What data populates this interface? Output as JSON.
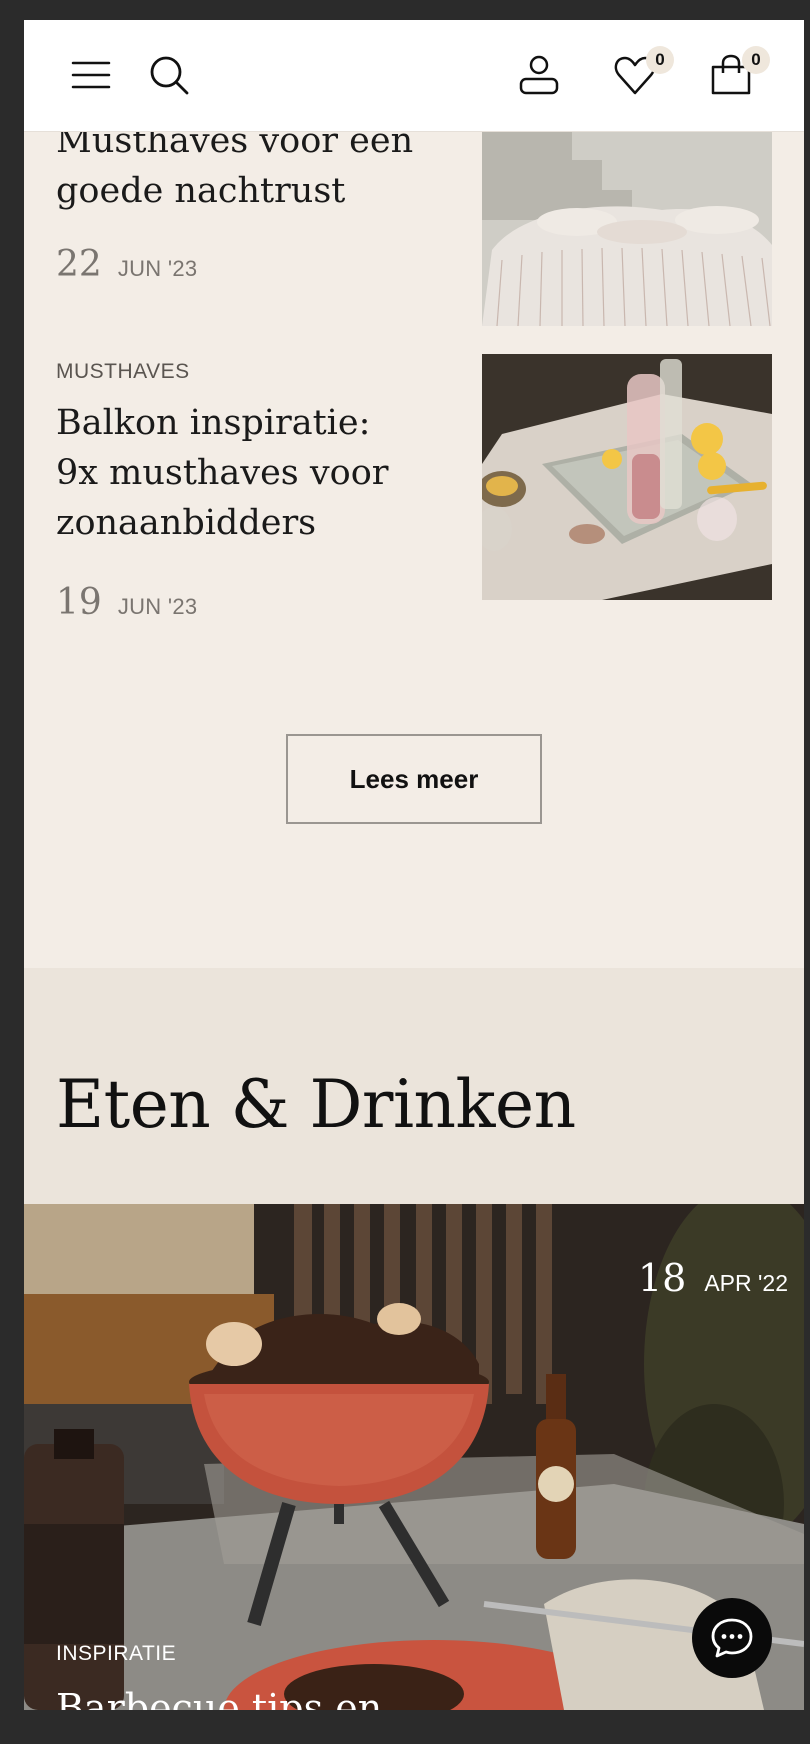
{
  "header": {
    "menu_icon": "hamburger-icon",
    "search_icon": "search-icon",
    "account_icon": "user-icon",
    "wishlist_icon": "heart-icon",
    "wishlist_count": "0",
    "cart_icon": "shopping-bag-icon",
    "cart_count": "0"
  },
  "articles": [
    {
      "category": "",
      "title": "Musthaves voor een goede nachtrust",
      "day": "22",
      "month": "JUN '23"
    },
    {
      "category": "MUSTHAVES",
      "title": "Balkon inspiratie: 9x musthaves voor zonaanbidders",
      "day": "19",
      "month": "JUN '23"
    }
  ],
  "more_button": "Lees meer",
  "section": {
    "title": "Eten & Drinken"
  },
  "hero": {
    "day": "18",
    "month": "APR '22",
    "category": "INSPIRATIE",
    "title": "Barbecue tips en..."
  },
  "chat_icon": "chat-bubble-icon",
  "colors": {
    "page_bg": "#f3ede6",
    "section_bg": "#ebe4db",
    "header_bg": "#ffffff",
    "badge_bg": "#efe7dc",
    "chat_bg": "#0a0a0a"
  }
}
